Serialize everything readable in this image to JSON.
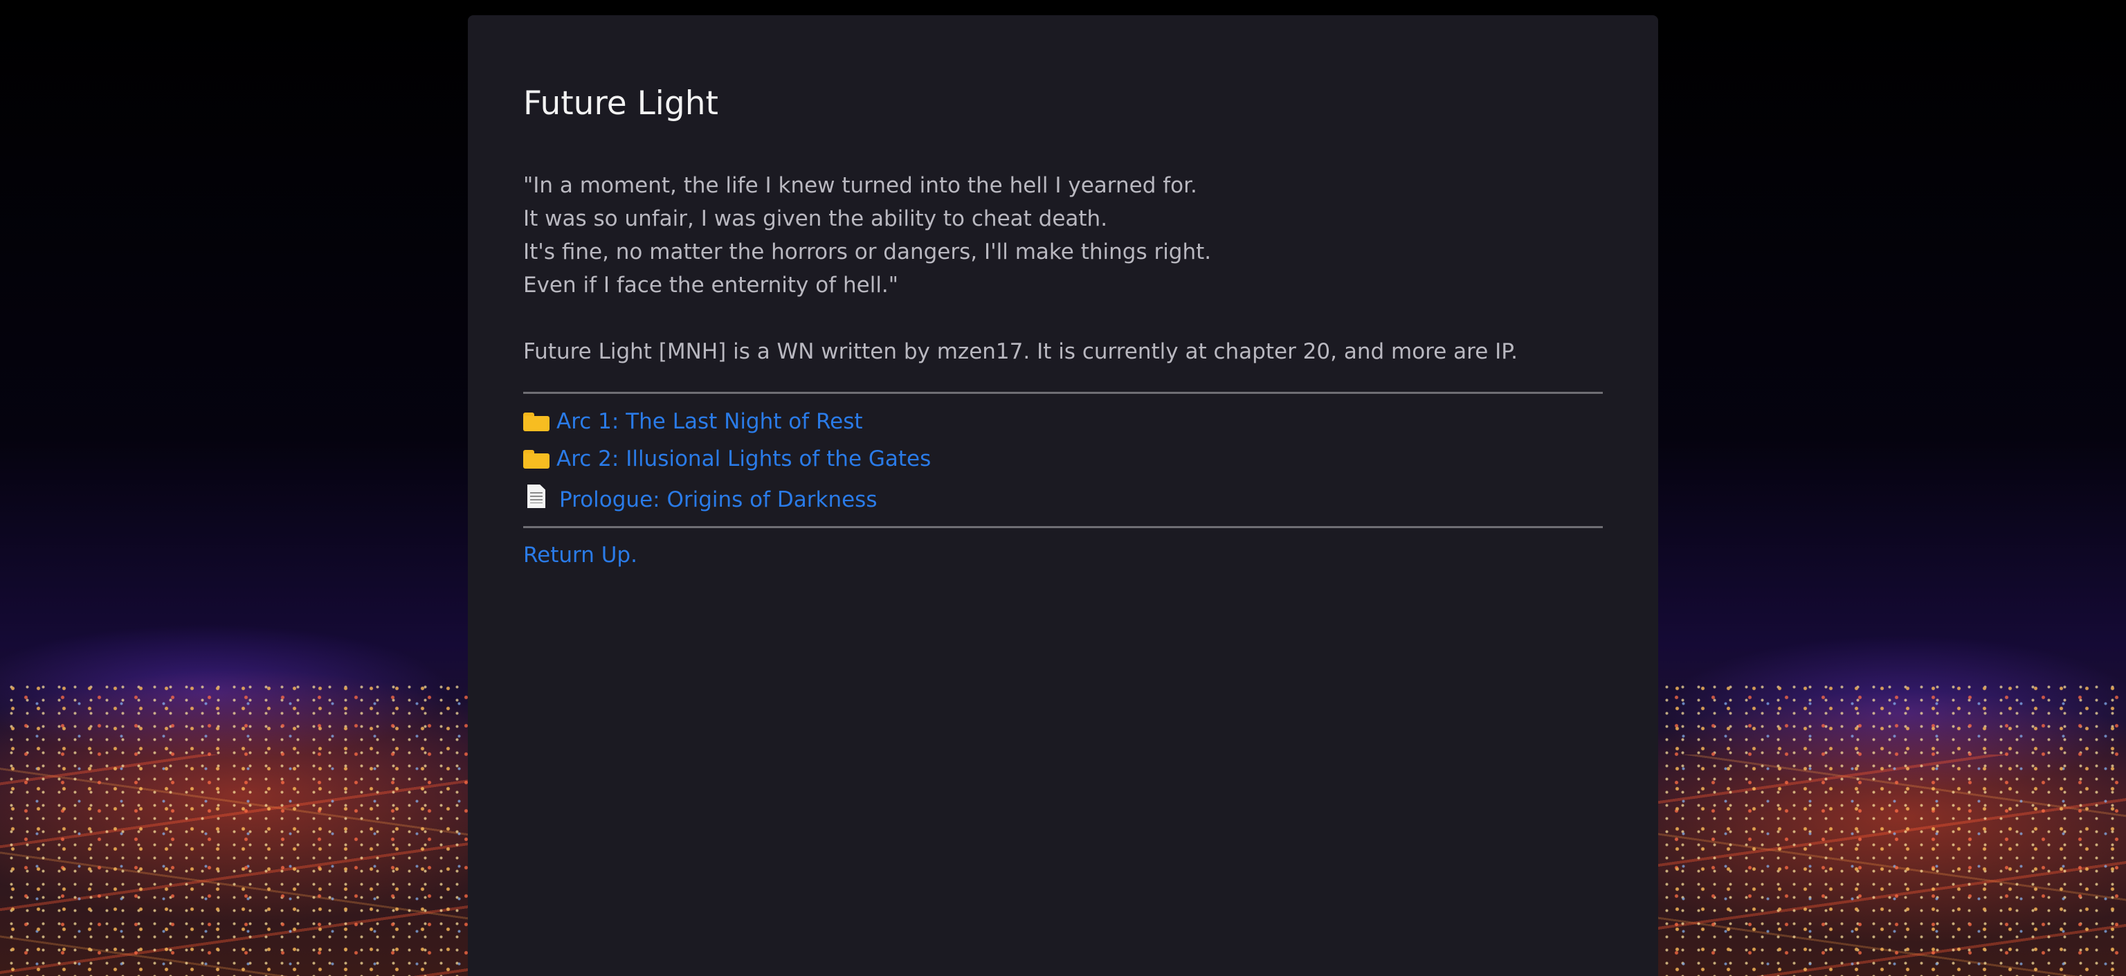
{
  "page": {
    "title": "Future Light",
    "quote_lines": [
      "\"In a moment, the life I knew turned into the hell I yearned for.",
      "It was so unfair, I was given the ability to cheat death.",
      "It's fine, no matter the horrors or dangers, I'll make things right.",
      "Even if I face the enternity of hell.\""
    ],
    "summary": "Future Light [MNH] is a WN written by mzen17. It is currently at chapter 20, and more are IP."
  },
  "entries": [
    {
      "icon": "folder-icon",
      "label": "Arc 1: The Last Night of Rest"
    },
    {
      "icon": "folder-icon",
      "label": "Arc 2: Illusional Lights of the Gates"
    },
    {
      "icon": "document-icon",
      "label": "Prologue: Origins of Darkness"
    }
  ],
  "footer": {
    "return_label": "Return Up."
  },
  "colors": {
    "panel_bg": "#1b1a22",
    "link": "#2a7be8",
    "folder": "#f7bd21",
    "text": "#b9b8c0",
    "title": "#f2f2f2"
  }
}
